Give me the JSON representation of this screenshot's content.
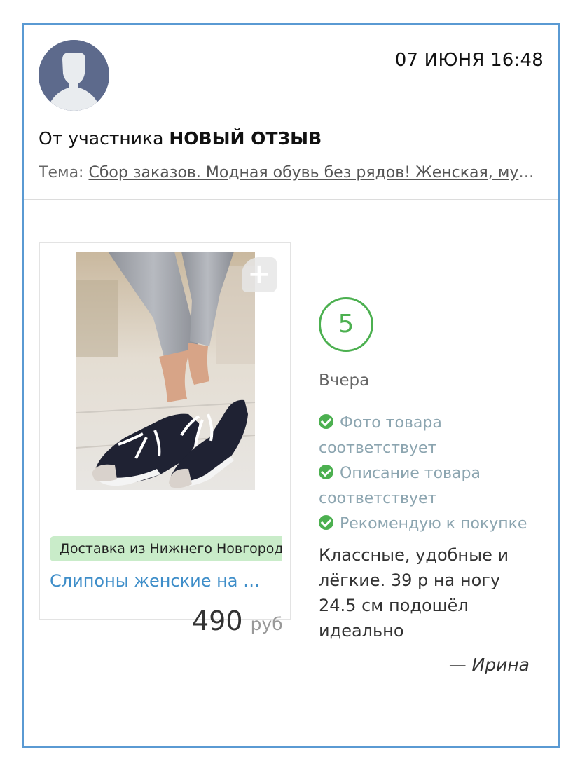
{
  "header": {
    "datetime": "07 ИЮНЯ 16:48",
    "from_prefix": "От участника",
    "from_name": "НОВЫЙ ОТЗЫВ",
    "topic_label": "Тема:",
    "topic_link": "Сбор заказов. Модная обувь без рядов! Женская, мужская, детская"
  },
  "product": {
    "add_icon": "plus-icon",
    "delivery_tag": "Доставка из Нижнего Новгорода",
    "title": "Слипоны женские на шнурках",
    "price": "490",
    "currency": "руб"
  },
  "review": {
    "rating": "5",
    "date": "Вчера",
    "checks": [
      {
        "icon": "check-circle-icon",
        "label": "Фото товара соответствует"
      },
      {
        "icon": "check-circle-icon",
        "label": "Описание товара соответствует"
      },
      {
        "icon": "check-circle-icon",
        "label": "Рекомендую к покупке"
      }
    ],
    "text": "Классные, удобные и лёгкие. 39 р на ногу 24.5 см подошёл идеально",
    "author": "— Ирина"
  },
  "colors": {
    "frame_border": "#5a9ad3",
    "accent_green": "#4cb050",
    "link_blue": "#3f8ec9",
    "tag_green": "#c9ecc9"
  }
}
